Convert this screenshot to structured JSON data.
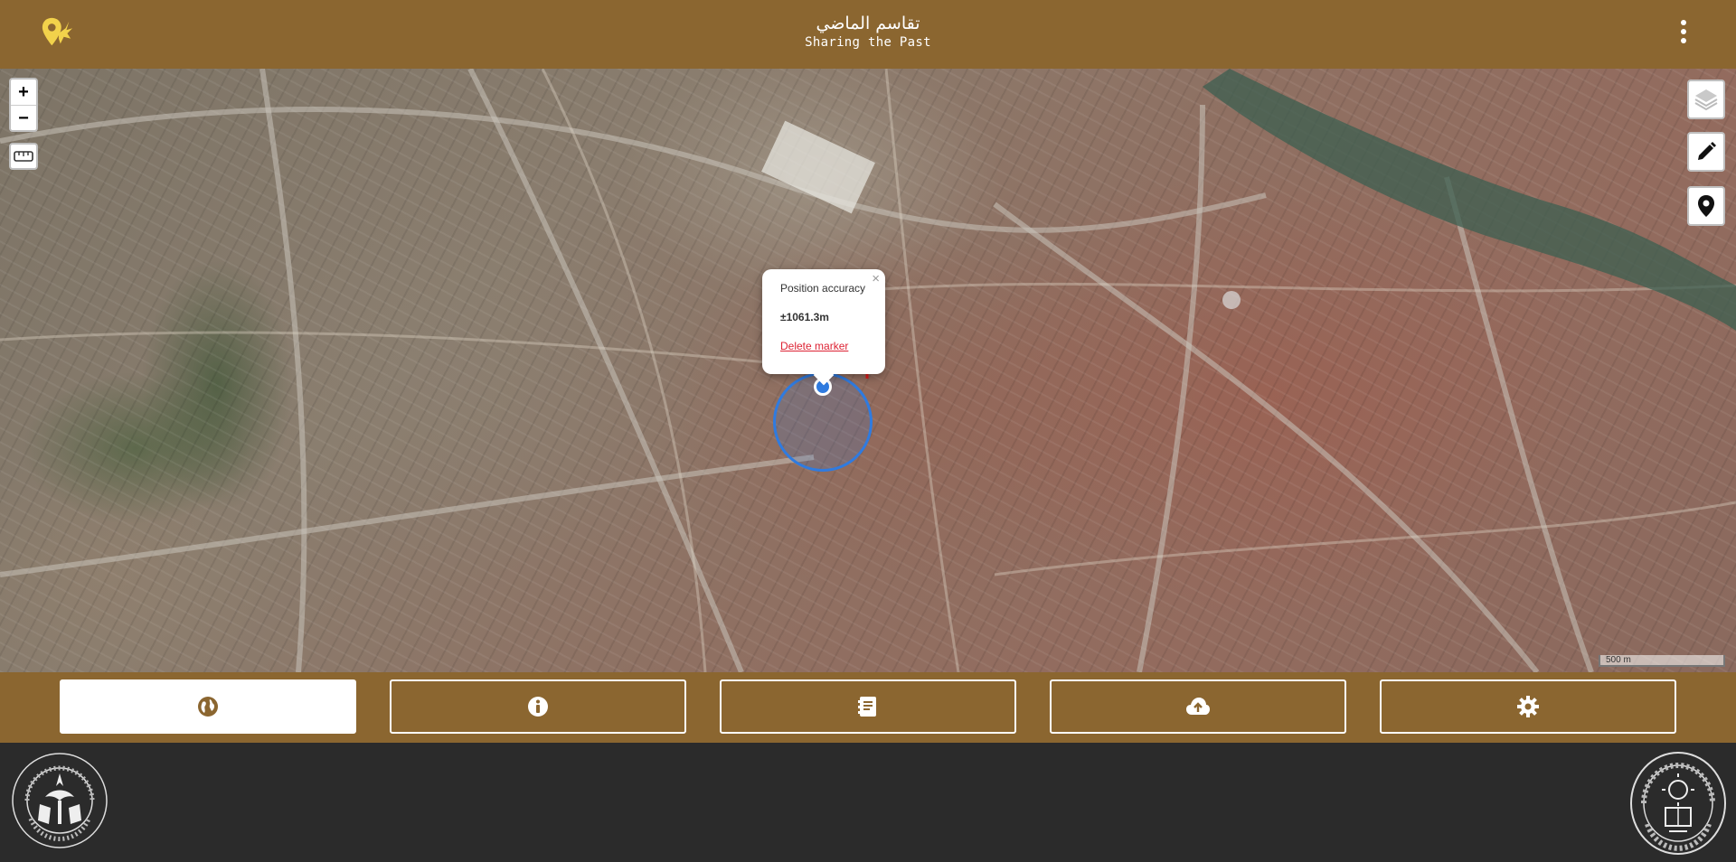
{
  "header": {
    "title_ar": "تقاسم الماضي",
    "title_en": "Sharing the Past",
    "logo_icon": "map-marker-griffin-icon",
    "menu_icon": "kebab-menu-icon"
  },
  "map": {
    "zoom_in_label": "+",
    "zoom_out_label": "−",
    "popup": {
      "close_label": "×",
      "accuracy_label": "Position accuracy",
      "accuracy_value": "±1061.3m",
      "delete_label": "Delete marker"
    },
    "scale_label": "500 m",
    "colors": {
      "location_blue": "#2f7be0",
      "cross_red": "#e01b1b"
    }
  },
  "tabs": [
    {
      "icon": "globe-icon",
      "active": true
    },
    {
      "icon": "info-icon",
      "active": false
    },
    {
      "icon": "book-icon",
      "active": false
    },
    {
      "icon": "cloud-upload-icon",
      "active": false
    },
    {
      "icon": "gear-icon",
      "active": false
    }
  ],
  "footer": {
    "left_seal_text": "حكومة الشارقة - هيئة الشارقة للآثار · Sharjah Archaeology Authority · Govt of Sharjah",
    "right_seal_text": "UNIVERSIDAD POLITÉCNICA · MADRID"
  },
  "theme": {
    "brand": "#8b6630",
    "footer_bg": "#2b2b2b"
  }
}
